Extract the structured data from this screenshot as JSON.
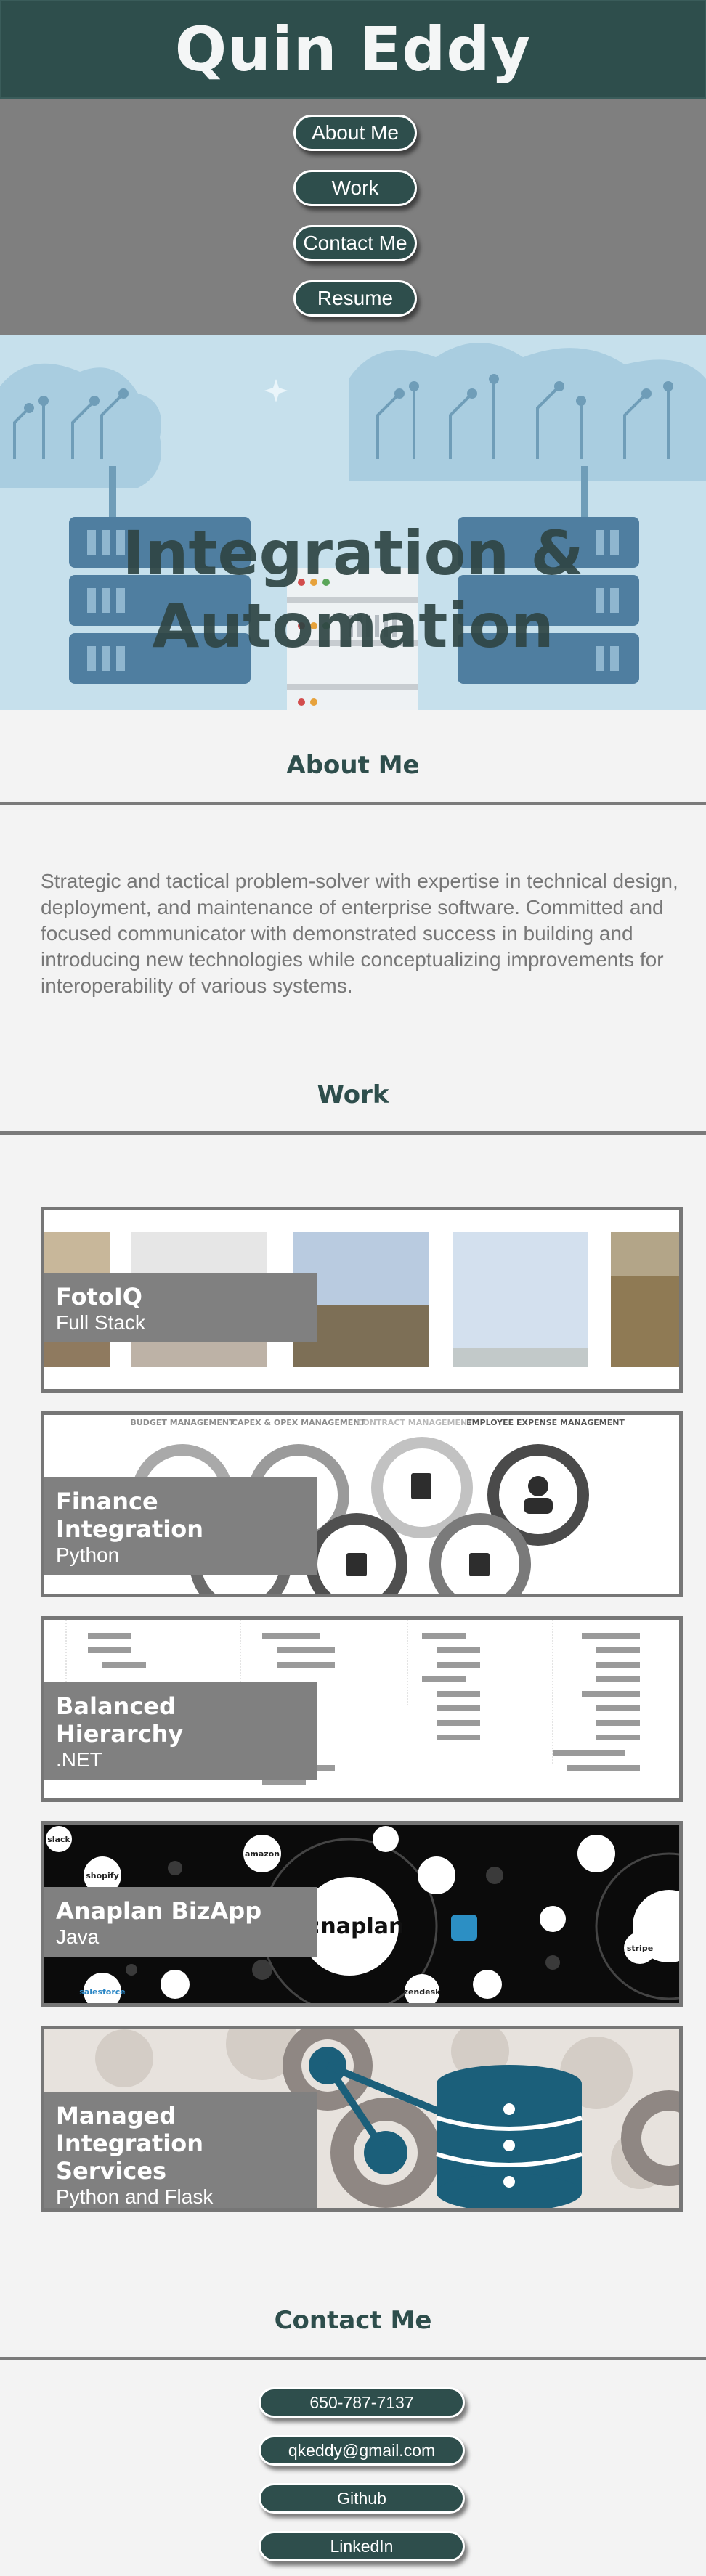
{
  "header": {
    "title": "Quin Eddy"
  },
  "nav": {
    "items": [
      "About Me",
      "Work",
      "Contact Me",
      "Resume"
    ]
  },
  "hero": {
    "title_line1": "Integration &",
    "title_line2": "Automation"
  },
  "about": {
    "heading": "About Me",
    "text": "Strategic and tactical problem-solver with expertise in technical design, deployment, and maintenance of enterprise software. Committed and focused communicator with demonstrated success in building and introducing new technologies while conceptualizing improvements for interoperability of various systems."
  },
  "work": {
    "heading": "Work",
    "projects": [
      {
        "title": "FotoIQ",
        "subtitle": "Full Stack"
      },
      {
        "title": "Finance Integration",
        "subtitle": "Python",
        "image_labels": [
          "BUDGET MANAGEMENT",
          "CAPEX & OPEX MANAGEMENT",
          "CONTRACT MANAGEMENT",
          "EMPLOYEE EXPENSE MANAGEMENT"
        ]
      },
      {
        "title": "Balanced Hierarchy",
        "subtitle": ".NET"
      },
      {
        "title": "Anaplan BizApp",
        "subtitle": "Java",
        "image_labels": [
          "slack",
          "amazon",
          "shopify",
          "salesforce",
          "stripe",
          "zendesk",
          "A:naplan"
        ]
      },
      {
        "title": "Managed Integration Services",
        "title_line1": "Managed",
        "title_line2": "Integration Services",
        "subtitle": "Python and Flask"
      }
    ]
  },
  "contact": {
    "heading": "Contact Me",
    "items": [
      "650-787-7137",
      "qkeddy@gmail.com",
      "Github",
      "LinkedIn"
    ]
  },
  "colors": {
    "primary": "#2e4e4c",
    "nav_bg": "#7f7f7f",
    "page_bg": "#f3f3f3",
    "hero_bg": "#c9e3ef",
    "text_muted": "#777777"
  }
}
